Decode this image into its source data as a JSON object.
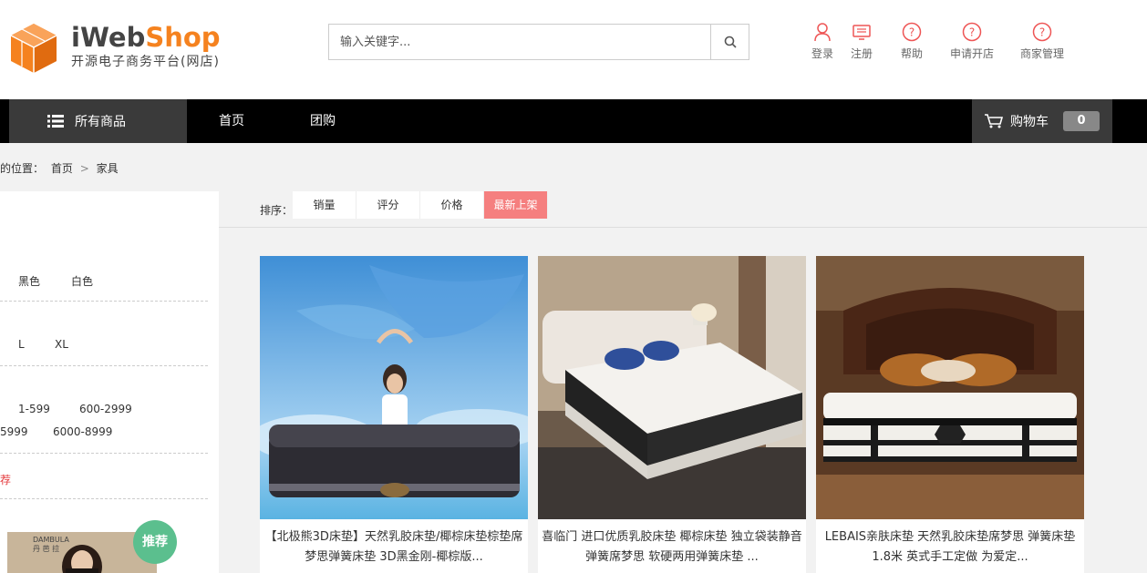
{
  "header": {
    "logo": {
      "brand_i": "iWeb",
      "brand_s": "Shop",
      "subtitle": "开源电子商务平台(网店)"
    },
    "search": {
      "placeholder": "输入关键字..."
    },
    "links": [
      {
        "label": "登录",
        "icon": "user-icon"
      },
      {
        "label": "注册",
        "icon": "register-icon"
      },
      {
        "label": "帮助",
        "icon": "help-icon"
      },
      {
        "label": "申请开店",
        "icon": "help-icon"
      },
      {
        "label": "商家管理",
        "icon": "help-icon"
      }
    ]
  },
  "nav": {
    "all_products": "所有商品",
    "links": [
      "首页",
      "团购"
    ],
    "cart_label": "购物车",
    "cart_count": "0"
  },
  "breadcrumb": {
    "prefix": "的位置：",
    "home": "首页",
    "separator": ">",
    "current": "家具"
  },
  "sidebar": {
    "colors": [
      "黑色",
      "白色"
    ],
    "sizes": [
      "L",
      "XL"
    ],
    "prices_row1": [
      "1-599",
      "600-2999"
    ],
    "prices_row2": [
      "5999",
      "6000-8999"
    ],
    "red_text": "荐",
    "ad_brand": "DAMBULA",
    "ad_sub": "丹 芭 拉",
    "recommend_badge": "推荐"
  },
  "sort": {
    "label": "排序：",
    "options": [
      "销量",
      "评分",
      "价格",
      "最新上架"
    ],
    "active": "最新上架"
  },
  "products": [
    {
      "title": "【北极熊3D床垫】天然乳胶床垫/椰棕床垫棕垫席梦思弹簧床垫 3D黑金刚-椰棕版..."
    },
    {
      "title": "喜临门 进口优质乳胶床垫 椰棕床垫 独立袋装静音弹簧席梦思 软硬两用弹簧床垫 ..."
    },
    {
      "title": "LEBAIS亲肤床垫 天然乳胶床垫席梦思 弹簧床垫1.8米 英式手工定做 为爱定..."
    }
  ],
  "colors": {
    "brand_orange": "#f5821f",
    "nav_bg": "#000000",
    "active_sort": "#f57f7f",
    "accent_red": "#e4393c",
    "badge_green": "#5bbf8e"
  }
}
